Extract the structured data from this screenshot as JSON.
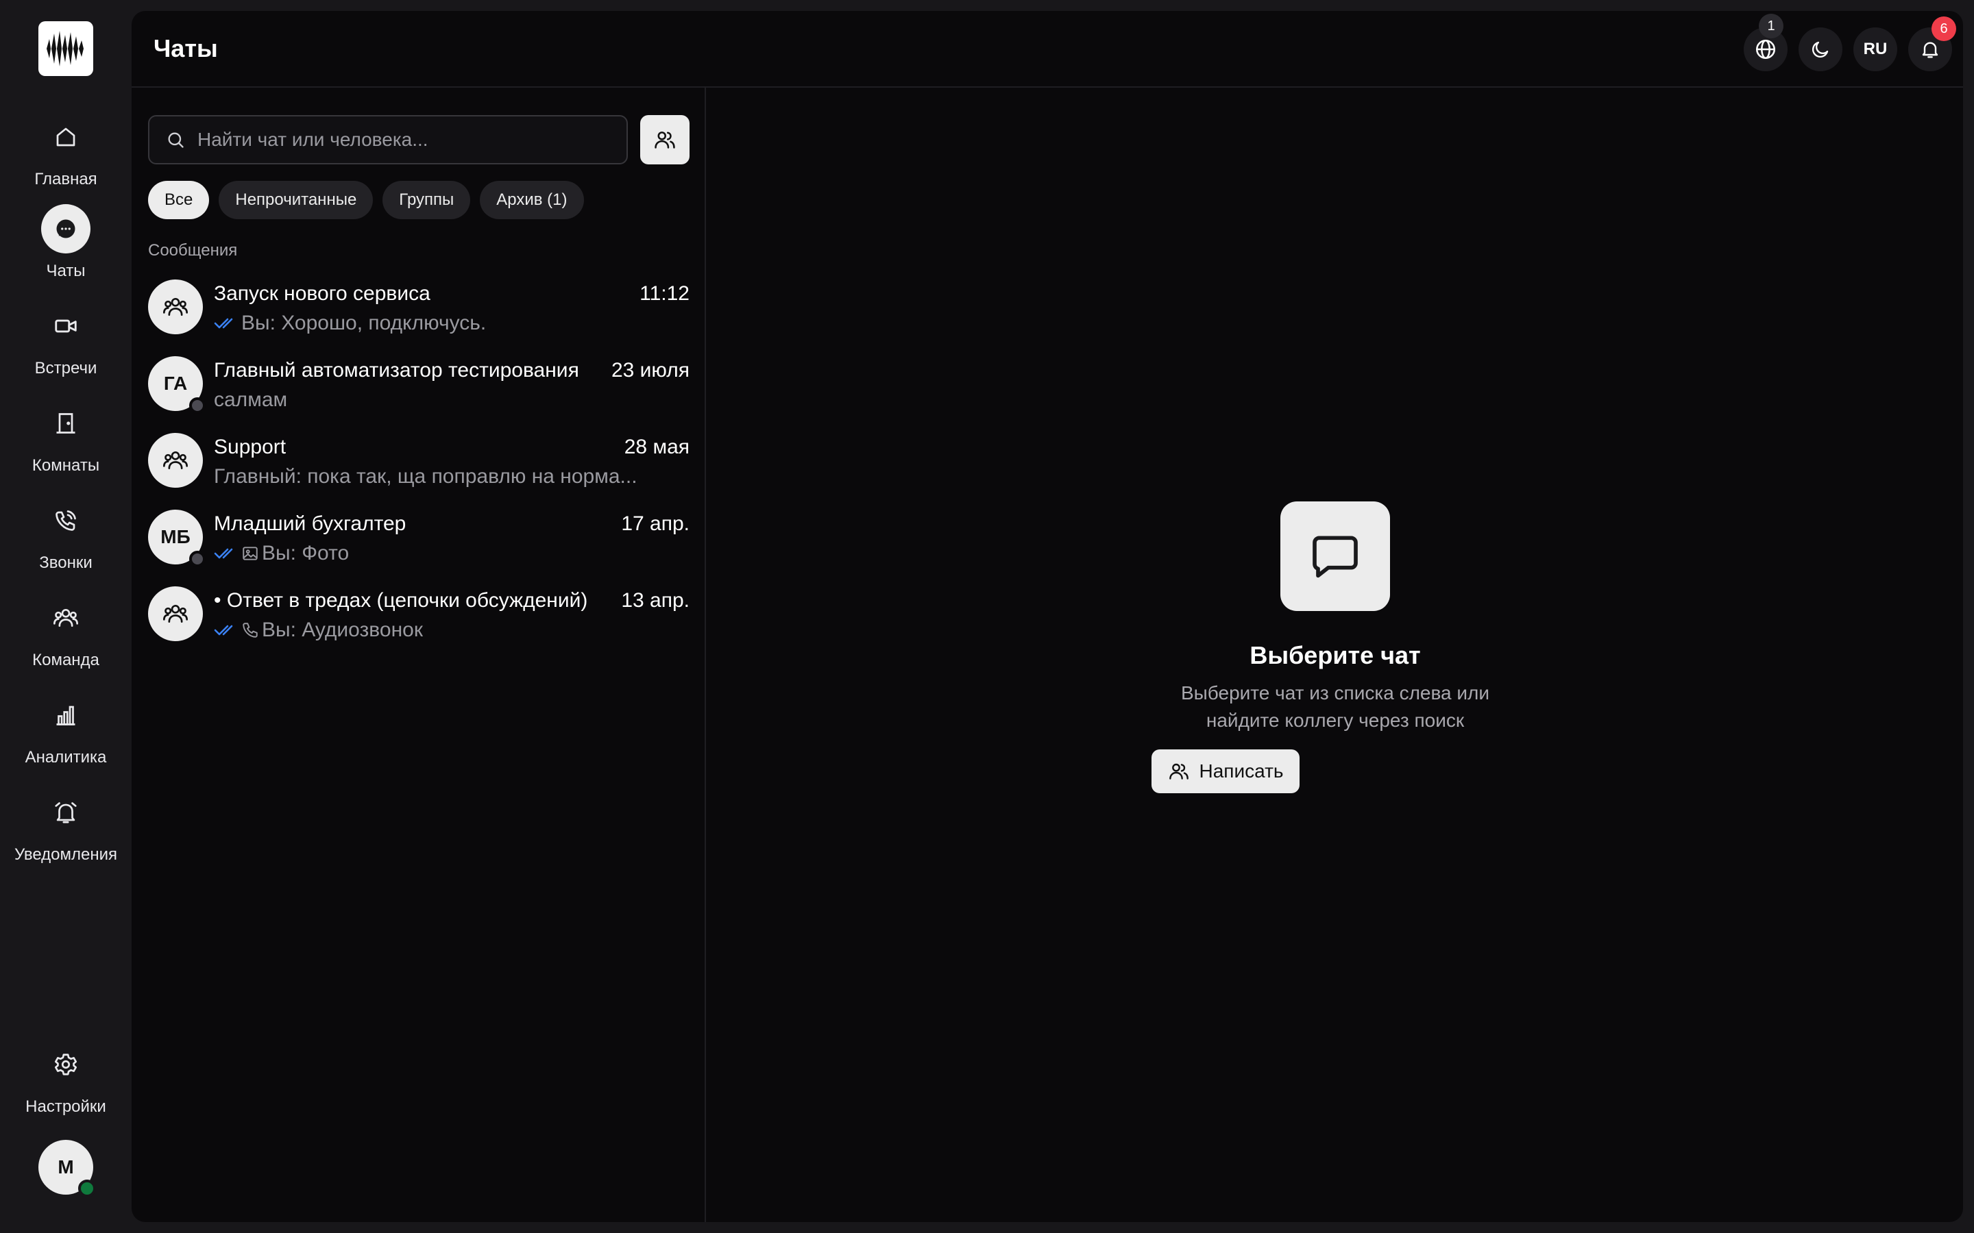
{
  "nav": {
    "items": [
      {
        "label": "Главная",
        "icon": "home-icon"
      },
      {
        "label": "Чаты",
        "icon": "chat-bubble-icon",
        "active": true
      },
      {
        "label": "Встречи",
        "icon": "video-camera-icon"
      },
      {
        "label": "Комнаты",
        "icon": "door-icon"
      },
      {
        "label": "Звонки",
        "icon": "phone-incoming-icon"
      },
      {
        "label": "Команда",
        "icon": "team-icon"
      },
      {
        "label": "Аналитика",
        "icon": "bar-chart-icon"
      },
      {
        "label": "Уведомления",
        "icon": "alarm-bell-icon"
      }
    ],
    "settings_label": "Настройки",
    "user_initial": "M"
  },
  "header": {
    "title": "Чаты",
    "globe_badge": "1",
    "language": "RU",
    "notifications_badge": "6"
  },
  "search": {
    "placeholder": "Найти чат или человека..."
  },
  "filters": [
    "Все",
    "Непрочитанные",
    "Группы",
    "Архив (1)"
  ],
  "section_label": "Сообщения",
  "chats": [
    {
      "name": "Запуск нового сервиса",
      "time": "11:12",
      "avatar": "group",
      "read_ticks": true,
      "preview": "Вы: Хорошо, подключусь."
    },
    {
      "name": "Главный автоматизатор тестирования",
      "time": "23 июля",
      "avatar": "ГА",
      "preview": "салмам"
    },
    {
      "name": "Support",
      "time": "28 мая",
      "avatar": "group",
      "preview": "Главный: пока так, ща поправлю на норма..."
    },
    {
      "name": "Младший бухгалтер",
      "time": "17 апр.",
      "avatar": "МБ",
      "read_ticks": true,
      "attachment_icon": "image-icon",
      "preview": "Вы: Фото"
    },
    {
      "name": "• Ответ в тредах (цепочки обсуждений)",
      "time": "13 апр.",
      "avatar": "group",
      "read_ticks": true,
      "attachment_icon": "phone-icon",
      "preview": "Вы: Аудиозвонок"
    }
  ],
  "empty_state": {
    "title": "Выберите чат",
    "subtitle": "Выберите чат из списка слева или найдите коллегу через поиск",
    "button": "Написать"
  },
  "colors": {
    "background": "#18171a",
    "panel": "#0a090b",
    "accent_light": "#ececec",
    "read_tick": "#3b82f6",
    "badge_red": "#ef3d4a",
    "online": "#0f7a3d"
  }
}
